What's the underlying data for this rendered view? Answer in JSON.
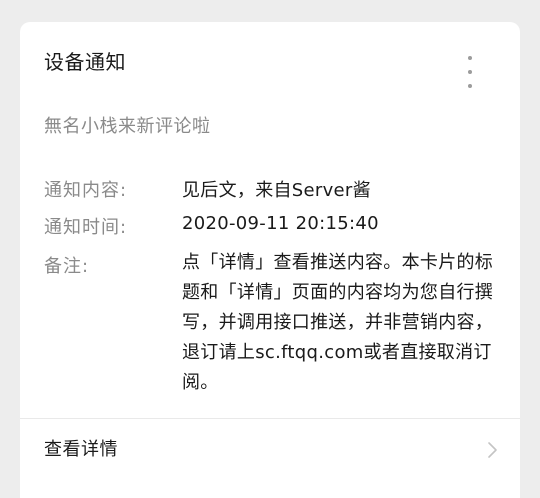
{
  "card": {
    "title": "设备通知",
    "subtitle": "無名小栈来新评论啦",
    "more_icon": "more-vertical-icon",
    "fields": {
      "content": {
        "label": "通知内容:",
        "value": "见后文，来自Server酱"
      },
      "time": {
        "label": "通知时间:",
        "value": "2020-09-11 20:15:40"
      },
      "remark": {
        "label": "备注:",
        "value": "点「详情」查看推送内容。本卡片的标题和「详情」页面的内容均为您自行撰写，并调用接口推送，并非营销内容，退订请上sc.ftqq.com或者直接取消订阅。"
      }
    },
    "footer": {
      "details_label": "查看详情",
      "icon": "chevron-right-icon"
    }
  }
}
